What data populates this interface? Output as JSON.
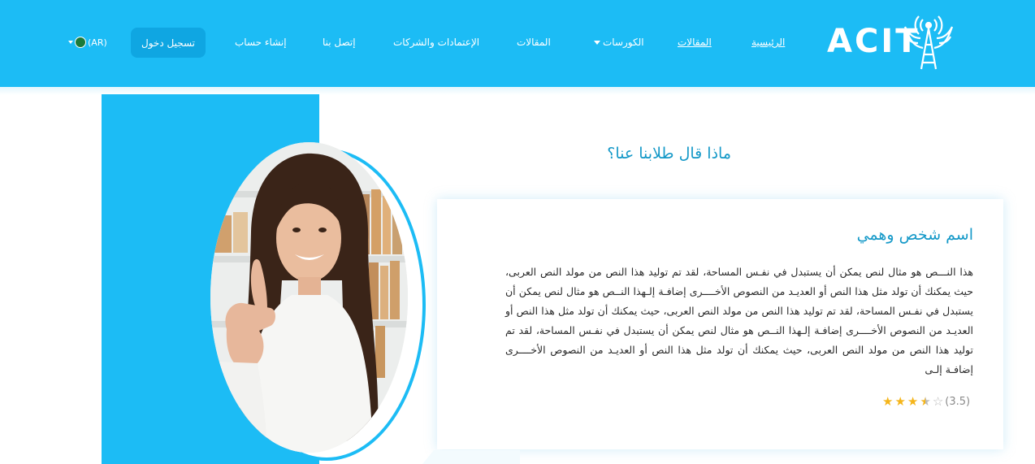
{
  "header": {
    "logo_text": "ACIT",
    "nav": {
      "home": "الرئيسية",
      "articles_active": "المقالات",
      "courses": "الكورسات",
      "articles": "المقالات",
      "accreditations": "الإعتمادات والشركات",
      "contact": "إتصل بنا",
      "register": "إنشاء حساب",
      "login": "تسجيل دخول",
      "language": "(AR)"
    },
    "colors": {
      "bar": "#1cbcf5",
      "login_button": "#0fa6e2"
    }
  },
  "testimonials": {
    "heading": "ماذا قال طلابنا عنا؟",
    "card": {
      "name": "اسم شخص وهمي",
      "body": "هذا النـــص هو مثال لنص يمكن أن يستبدل في نفـس المساحة، لقد تم توليد هذا النص من مولد النص العربى، حيث يمكنك أن تولد مثل هذا النص أو العديـد من النصوص الأخــــرى إضافـة إلـهذا النــص هو مثال لنص يمكن أن يستبدل في نفـس المساحة، لقد تم توليد هذا النص من مولد النص العربى، حيث يمكنك أن تولد مثل هذا النص أو العديـد من النصوص الأخــــرى إضافـة إلـهذا النــص هو مثال لنص يمكن أن يستبدل في نفـس المساحة، لقد تم توليد هذا النص من مولد النص العربى، حيث يمكنك أن تولد مثل هذا النص أو العديـد من النصوص الأخــــرى إضافـة إلـى",
      "rating_value": "(3.5)",
      "rating": 3.5,
      "rating_max": 5
    },
    "colors": {
      "accent": "#1cbcf5",
      "title": "#1599c8",
      "star": "#f5b51a"
    }
  }
}
